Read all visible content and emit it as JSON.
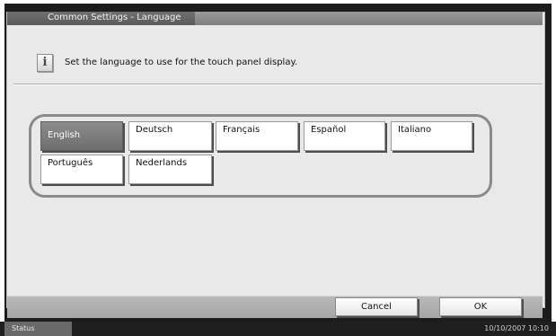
{
  "header": {
    "title": "Common Settings - Language"
  },
  "info": {
    "icon": "info-icon",
    "glyph": "i",
    "instruction": "Set the language to use for the touch panel display."
  },
  "languages": {
    "selected": "English",
    "items": [
      {
        "label": "English"
      },
      {
        "label": "Deutsch"
      },
      {
        "label": "Français"
      },
      {
        "label": "Español"
      },
      {
        "label": "Italiano"
      },
      {
        "label": "Português"
      },
      {
        "label": "Nederlands"
      }
    ]
  },
  "footer": {
    "cancel_label": "Cancel",
    "ok_label": "OK"
  },
  "status": {
    "label": "Status",
    "datetime": "10/10/2007   10:10"
  }
}
